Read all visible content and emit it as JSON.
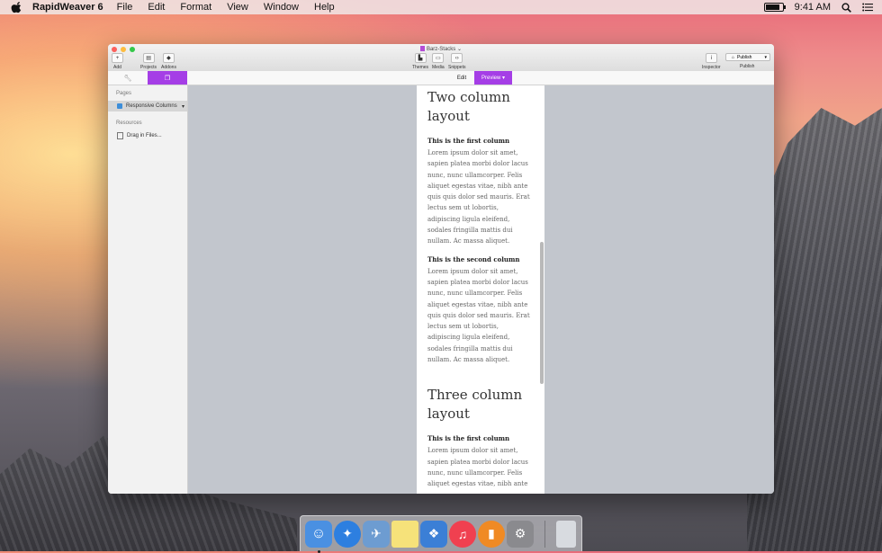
{
  "menubar": {
    "app_name": "RapidWeaver 6",
    "menus": [
      "File",
      "Edit",
      "Format",
      "View",
      "Window",
      "Help"
    ],
    "clock": "9:41 AM",
    "battery_level": 0.85
  },
  "window": {
    "title": "Barz-Stacks",
    "toolbar": {
      "add": "Add",
      "projects": "Projects",
      "addons": "Addons",
      "themes": "Themes",
      "media": "Media",
      "snippets": "Snippets",
      "inspector": "Inspector",
      "publish_button": "Publish",
      "publish_label": "Publish"
    },
    "modes": {
      "edit": "Edit",
      "preview": "Preview"
    },
    "sidebar": {
      "pages_header": "Pages",
      "page_item": "Responsive Columns",
      "resources_header": "Resources",
      "resources_item": "Drag in Files..."
    },
    "preview": {
      "section1_title": "Two column layout",
      "col1_heading": "This is the first column",
      "col1_text": "Lorem ipsum dolor sit amet, sapien platea morbi dolor lacus nunc, nunc ullamcorper. Felis aliquet egestas vitae, nibh ante quis quis dolor sed mauris. Erat lectus sem ut lobortis, adipiscing ligula eleifend, sodales fringilla mattis dui nullam. Ac massa aliquet.",
      "col2_heading": "This is the second column",
      "col2_text": "Lorem ipsum dolor sit amet, sapien platea morbi dolor lacus nunc, nunc ullamcorper. Felis aliquet egestas vitae, nibh ante quis quis dolor sed mauris. Erat lectus sem ut lobortis, adipiscing ligula eleifend, sodales fringilla mattis dui nullam. Ac massa aliquet.",
      "section2_title": "Three column layout",
      "col3_heading": "This is the first column",
      "col3_text": "Lorem ipsum dolor sit amet, sapien platea morbi dolor lacus nunc, nunc ullamcorper. Felis aliquet egestas vitae, nibh ante"
    }
  },
  "colors": {
    "accent": "#a53ee6",
    "canvas": "#c2c6cd"
  },
  "dock": {
    "apps": [
      {
        "icon": "finder-icon",
        "color": "#4a90e2"
      },
      {
        "icon": "safari-icon",
        "color": "#2d7fe0"
      },
      {
        "icon": "mail-icon",
        "color": "#6d9cd1"
      },
      {
        "icon": "notes-icon",
        "color": "#f6e27a"
      },
      {
        "icon": "rapidweaver-icon",
        "color": "#3b7fd6"
      },
      {
        "icon": "itunes-icon",
        "color": "#f04050"
      },
      {
        "icon": "ibooks-icon",
        "color": "#f08a24"
      },
      {
        "icon": "system-preferences-icon",
        "color": "#8a8a8e"
      },
      {
        "icon": "trash-icon",
        "color": "#d8dbe0"
      }
    ]
  }
}
